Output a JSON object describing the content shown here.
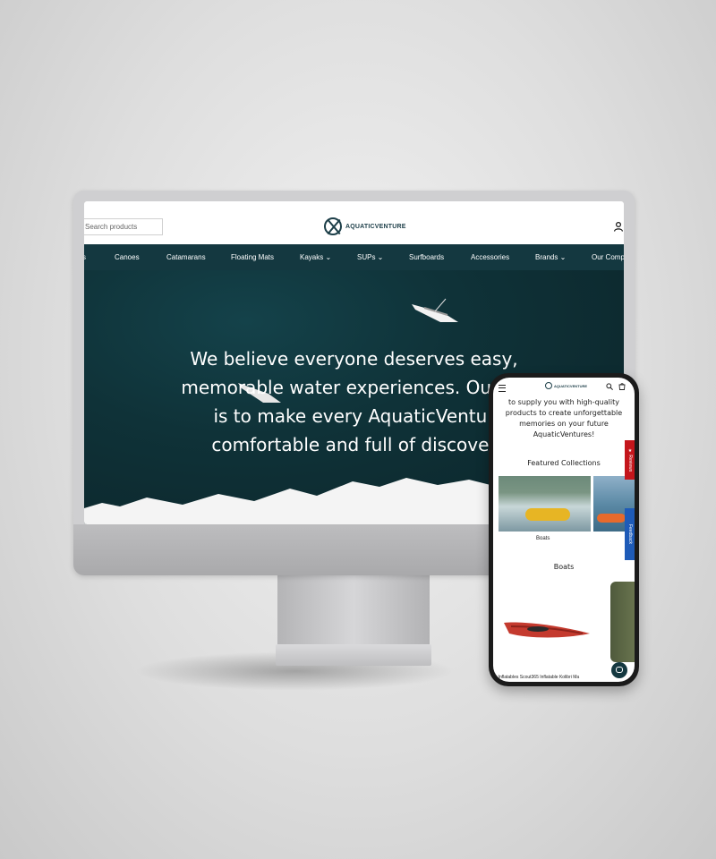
{
  "desktop": {
    "search_placeholder": "Search products",
    "logo_text": "AQUATICVENTURE",
    "nav_items": [
      "s",
      "Canoes",
      "Catamarans",
      "Floating Mats",
      "Kayaks ⌄",
      "SUPs ⌄",
      "Surfboards",
      "Accessories",
      "Brands ⌄",
      "Our Comp"
    ],
    "hero_lines": [
      "We believe everyone deserves easy,",
      "memorable water experiences. Our mi",
      "is to make every AquaticVentur",
      "comfortable and full of discover"
    ]
  },
  "mobile": {
    "logo_text": "AQUATICVENTURE",
    "mission_lines": [
      "to supply you with high-quality",
      "products to create unforgettable",
      "memories on your future",
      "AquaticVentures!"
    ],
    "featured_title": "Featured Collections",
    "card_label": "Boats",
    "boats_title": "Boats",
    "product_text": "nt Inflatables Scout365 Inflatable    Kolibri Ma",
    "reviews_tab": "★ Reviews",
    "feedback_tab": "Feedback"
  },
  "colors": {
    "nav_bg": "#143840",
    "brand": "#1d3f49",
    "reviews": "#c4161c",
    "feedback": "#1e5bb8"
  }
}
